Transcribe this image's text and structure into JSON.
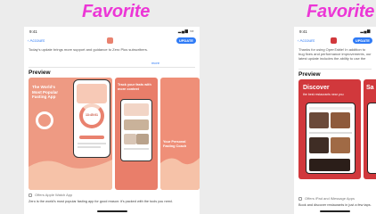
{
  "favorites": [
    {
      "label": "Favorite",
      "color": "#ec36d6"
    },
    {
      "label": "Favorite",
      "color": "#ec36d6"
    }
  ],
  "left_phone": {
    "status_time": "9:41",
    "back_label": "Account",
    "update_label": "UPDATE",
    "notes": "Today's update brings more support and guidance to Zero Plus subscribers.",
    "more": "more",
    "preview_title": "Preview",
    "shot1": {
      "headline": "The World's Most Popular Fasting App",
      "ring_time": "13:45:01"
    },
    "shot2": {
      "headline": "Track your fasts with more context"
    },
    "shot3": {
      "headline": "Your Personal Fasting Coach"
    },
    "offers": "Offers Apple Watch App",
    "description": "Zero is the world's most popular fasting app for good reason: it's packed with the tools you need."
  },
  "right_phone": {
    "status_time": "9:41",
    "back_label": "Account",
    "update_label": "UPDATE",
    "notes": "Thanks for using OpenTable! In addition to bug fixes and performance improvements, our latest update includes the ability to use the",
    "more": "more",
    "preview_title": "Preview",
    "shot1": {
      "headline": "Discover",
      "subhead": "the best restaurants near you"
    },
    "shot2": {
      "headline": "Sa"
    },
    "offers": "Offers iPad and iMessage Apps",
    "description": "Book and discover restaurants in just a few taps."
  },
  "colors": {
    "zero_coral": "#e9826f",
    "zero_light": "#f7c9b6",
    "opentable_red": "#d1383c",
    "ios_blue": "#2f7bf6"
  }
}
